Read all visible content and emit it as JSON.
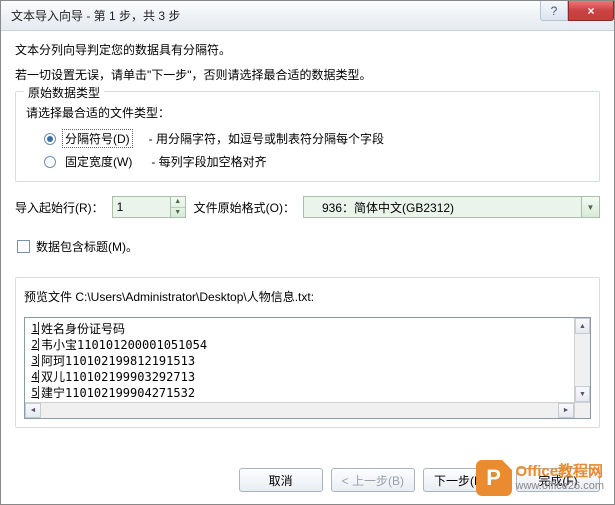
{
  "window": {
    "title": "文本导入向导 - 第 1 步，共 3 步",
    "help_symbol": "?",
    "close_symbol": "×"
  },
  "intro": {
    "line1": "文本分列向导判定您的数据具有分隔符。",
    "line2": "若一切设置无误，请单击\"下一步\"，否则请选择最合适的数据类型。"
  },
  "group": {
    "title": "原始数据类型",
    "instruction": "请选择最合适的文件类型：",
    "options": [
      {
        "label": "分隔符号(D)",
        "desc": "- 用分隔字符，如逗号或制表符分隔每个字段",
        "checked": true
      },
      {
        "label": "固定宽度(W)",
        "desc": "- 每列字段加空格对齐",
        "checked": false
      }
    ]
  },
  "inputs": {
    "start_row_label": "导入起始行(R)：",
    "start_row_value": "1",
    "encoding_label": "文件原始格式(O)：",
    "encoding_value": "936：简体中文(GB2312)"
  },
  "checkbox": {
    "label": "数据包含标题(M)。",
    "checked": false
  },
  "preview": {
    "title": "预览文件 C:\\Users\\Administrator\\Desktop\\人物信息.txt:",
    "lines": [
      "姓名身份证号码",
      "韦小宝110101200001051054",
      "阿珂110102199812191513",
      "双儿110102199903292713",
      "建宁110102199904271532"
    ]
  },
  "buttons": {
    "cancel": "取消",
    "back": "< 上一步(B)",
    "next": "下一步(N) >",
    "finish": "完成(F)"
  },
  "watermark": {
    "logo_letter": "P",
    "text_main": "Office教程网",
    "text_sub": "www.office26.com"
  }
}
